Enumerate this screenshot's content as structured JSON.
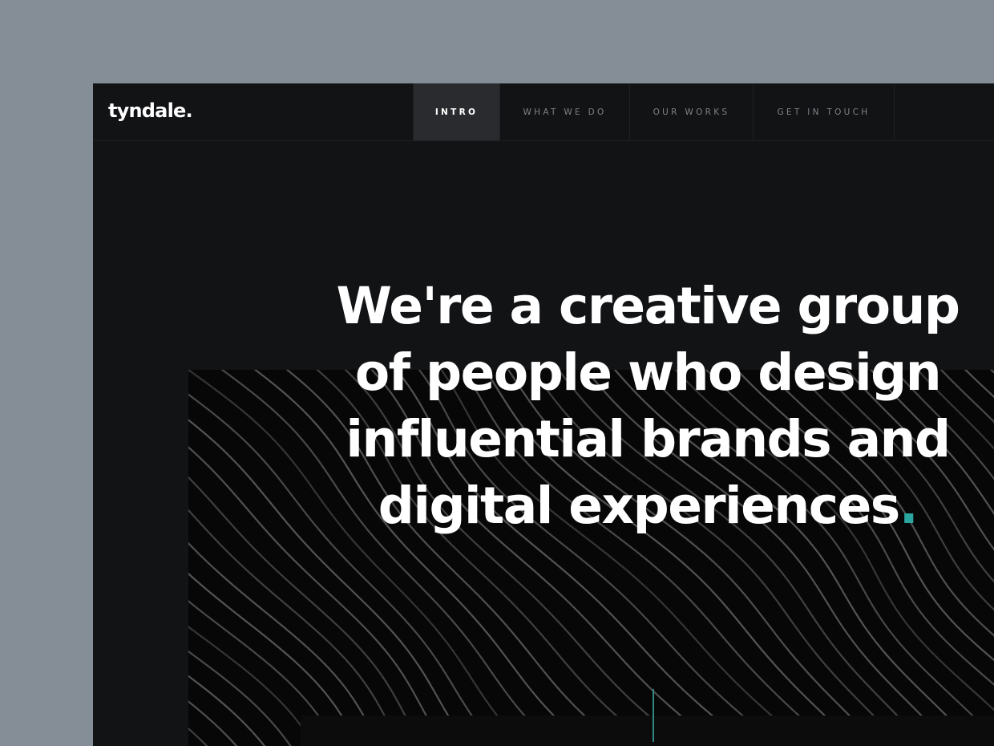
{
  "brand": {
    "logo_text": "tyndale."
  },
  "nav": {
    "items": [
      {
        "label": "INTRO",
        "active": true
      },
      {
        "label": "WHAT WE DO",
        "active": false
      },
      {
        "label": "OUR WORKS",
        "active": false
      },
      {
        "label": "GET IN TOUCH",
        "active": false
      }
    ]
  },
  "hero": {
    "headline_lines": [
      "We're a creative group",
      "of people who design",
      "influential brands and",
      "digital experiences"
    ],
    "headline_end": "."
  },
  "colors": {
    "accent": "#2aa5a0",
    "page_background": "#121315",
    "outer_background": "#858d96"
  }
}
